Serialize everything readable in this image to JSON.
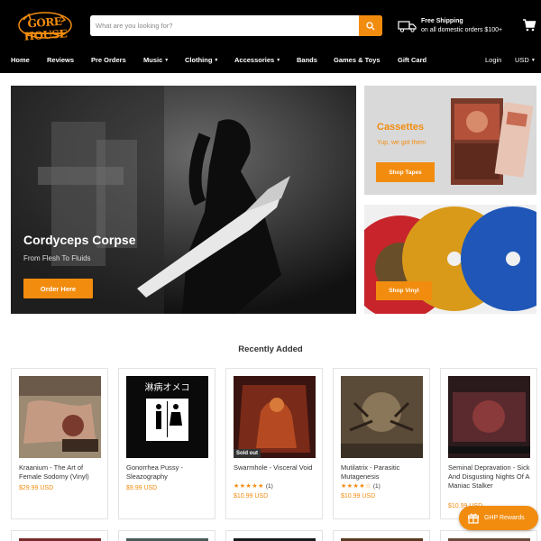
{
  "brand": {
    "logo_text": "GORE HOUSE",
    "accent_color": "#f28c0f"
  },
  "search": {
    "placeholder": "What are you looking for?"
  },
  "shipping": {
    "title": "Free Shipping",
    "subtitle": "on all domestic orders $100+"
  },
  "nav": {
    "items": [
      {
        "label": "Home"
      },
      {
        "label": "Reviews"
      },
      {
        "label": "Pre Orders"
      },
      {
        "label": "Music",
        "dropdown": true
      },
      {
        "label": "Clothing",
        "dropdown": true
      },
      {
        "label": "Accessories",
        "dropdown": true
      },
      {
        "label": "Bands"
      },
      {
        "label": "Games & Toys"
      },
      {
        "label": "Gift Card"
      }
    ],
    "login": "Login",
    "currency": "USD"
  },
  "hero": {
    "title": "Cordyceps Corpse",
    "subtitle": "From Flesh To Fluids",
    "button": "Order Here"
  },
  "promo_cassettes": {
    "title": "Cassettes",
    "subtitle": "Yup, we got them",
    "button": "Shop Tapes"
  },
  "promo_vinyl": {
    "button": "Shop Vinyl"
  },
  "recent": {
    "title": "Recently Added",
    "products": [
      {
        "title": "Kraanium - The Art of Female Sodomy (Vinyl)",
        "price": "$29.99 USD"
      },
      {
        "title": "Gonorrhea Pussy - Sleazography",
        "price": "$9.99 USD"
      },
      {
        "title": "Swarmhole - Visceral Void",
        "price": "$10.99 USD",
        "badge": "Sold out",
        "stars": "★★★★★",
        "rating": 5,
        "reviews": "(1)"
      },
      {
        "title": "Mutilatrix - Parasitic Mutagenesis",
        "price": "$10.99 USD",
        "stars": "★★★★☆",
        "rating": 4,
        "reviews": "(1)"
      },
      {
        "title": "Seminal Depravation - Sick And Disgusting Nights Of A Maniac Stalker",
        "price": "$10.99 USD"
      }
    ]
  },
  "rewards": {
    "label": "GHP Rewards"
  }
}
